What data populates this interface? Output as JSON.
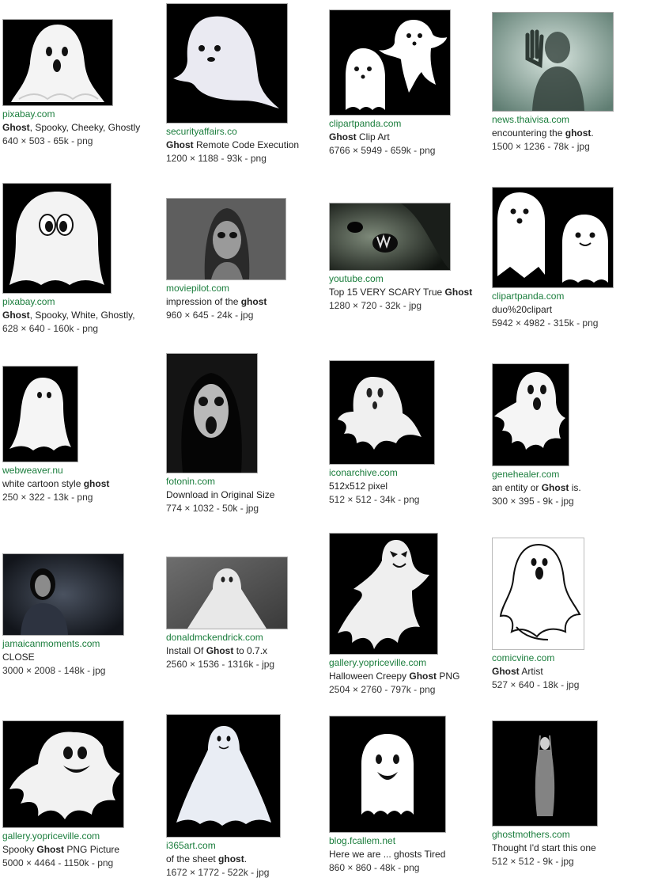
{
  "results": [
    {
      "source": "pixabay.com",
      "caption": [
        {
          "t": "Ghost",
          "b": true
        },
        {
          "t": ", Spooky, Cheeky, Ghostly",
          "b": false
        }
      ],
      "dims": "640 × 503 - 65k - png",
      "icon": "cartoon-ghost-oh-icon"
    },
    {
      "source": "securityaffairs.co",
      "caption": [
        {
          "t": "Ghost",
          "b": true
        },
        {
          "t": " Remote Code Execution",
          "b": false
        }
      ],
      "dims": "1200 × 1188 - 93k - png",
      "icon": "cartoon-ghost-side-icon"
    },
    {
      "source": "clipartpanda.com",
      "caption": [
        {
          "t": "Ghost",
          "b": true
        },
        {
          "t": " Clip Art",
          "b": false
        }
      ],
      "dims": "6766 × 5949 - 659k - png",
      "icon": "two-ghosts-icon"
    },
    {
      "source": "news.thaivisa.com",
      "caption": [
        {
          "t": "encountering the ",
          "b": false
        },
        {
          "t": "ghost",
          "b": true
        },
        {
          "t": ".",
          "b": false
        }
      ],
      "dims": "1500 × 1236 - 78k - jpg",
      "icon": "shadow-hand-photo"
    },
    {
      "source": "pixabay.com",
      "caption": [
        {
          "t": "Ghost",
          "b": true
        },
        {
          "t": ", Spooky, White, Ghostly,",
          "b": false
        }
      ],
      "dims": "628 × 640 - 160k - png",
      "icon": "cartoon-ghost-eyes-icon"
    },
    {
      "source": "moviepilot.com",
      "caption": [
        {
          "t": "impression of the ",
          "b": false
        },
        {
          "t": "ghost",
          "b": true
        }
      ],
      "dims": "960 × 645 - 24k - jpg",
      "icon": "girl-dark-eyes-photo"
    },
    {
      "source": "youtube.com",
      "caption": [
        {
          "t": "Top 15 VERY SCARY True ",
          "b": false
        },
        {
          "t": "Ghost",
          "b": true
        }
      ],
      "dims": "1280 × 720 - 32k - jpg",
      "icon": "scary-face-photo"
    },
    {
      "source": "clipartpanda.com",
      "caption": [
        {
          "t": "duo%20clipart",
          "b": false
        }
      ],
      "dims": "5942 × 4982 - 315k - png",
      "icon": "ghost-duo-icon"
    },
    {
      "source": "webweaver.nu",
      "caption": [
        {
          "t": "white cartoon style ",
          "b": false
        },
        {
          "t": "ghost",
          "b": true
        }
      ],
      "dims": "250 × 322 - 13k - png",
      "icon": "simple-ghost-icon"
    },
    {
      "source": "fotonin.com",
      "caption": [
        {
          "t": "Download in Original Size",
          "b": false
        }
      ],
      "dims": "774 × 1032 - 50k - jpg",
      "icon": "screaming-woman-photo"
    },
    {
      "source": "iconarchive.com",
      "caption": [
        {
          "t": "512x512 pixel",
          "b": false
        }
      ],
      "dims": "512 × 512 - 34k - png",
      "icon": "floating-ghost-icon"
    },
    {
      "source": "genehealer.com",
      "caption": [
        {
          "t": "an entity or ",
          "b": false
        },
        {
          "t": "Ghost",
          "b": true
        },
        {
          "t": " is.",
          "b": false
        }
      ],
      "dims": "300 × 395 - 9k - jpg",
      "icon": "screaming-ghost-icon"
    },
    {
      "source": "jamaicanmoments.com",
      "caption": [
        {
          "t": "CLOSE",
          "b": false
        }
      ],
      "dims": "3000 × 2008 - 148k - jpg",
      "icon": "dark-figure-photo"
    },
    {
      "source": "donaldmckendrick.com",
      "caption": [
        {
          "t": "Install Of ",
          "b": false
        },
        {
          "t": "Ghost",
          "b": true
        },
        {
          "t": " to 0.7.x",
          "b": false
        }
      ],
      "dims": "2560 × 1536 - 1316k - jpg",
      "icon": "sheet-ghost-photo"
    },
    {
      "source": "gallery.yopriceville.com",
      "caption": [
        {
          "t": "Halloween Creepy ",
          "b": false
        },
        {
          "t": "Ghost",
          "b": true
        },
        {
          "t": " PNG",
          "b": false
        }
      ],
      "dims": "2504 × 2760 - 797k - png",
      "icon": "creepy-ghost-icon"
    },
    {
      "source": "comicvine.com",
      "caption": [
        {
          "t": "Ghost",
          "b": true
        },
        {
          "t": " Artist",
          "b": false
        }
      ],
      "dims": "527 × 640 - 18k - jpg",
      "icon": "outline-ghost-icon"
    },
    {
      "source": "gallery.yopriceville.com",
      "caption": [
        {
          "t": "Spooky ",
          "b": false
        },
        {
          "t": "Ghost",
          "b": true
        },
        {
          "t": " PNG Picture",
          "b": false
        }
      ],
      "dims": "5000 × 4464 - 1150k - png",
      "icon": "grinning-ghost-icon"
    },
    {
      "source": "i365art.com",
      "caption": [
        {
          "t": "of the sheet ",
          "b": false
        },
        {
          "t": "ghost",
          "b": true
        },
        {
          "t": ".",
          "b": false
        }
      ],
      "dims": "1672 × 1772 - 522k - jpg",
      "icon": "sheet-ghost-figurine-icon"
    },
    {
      "source": "blog.fcallem.net",
      "caption": [
        {
          "t": "Here we are ... ghosts Tired",
          "b": false
        }
      ],
      "dims": "860 × 860 - 48k - png",
      "icon": "smiling-ghost-icon"
    },
    {
      "source": "ghostmothers.com",
      "caption": [
        {
          "t": "Thought I'd start this one",
          "b": false
        }
      ],
      "dims": "512 × 512 - 9k - jpg",
      "icon": "ghost-woman-photo"
    }
  ]
}
